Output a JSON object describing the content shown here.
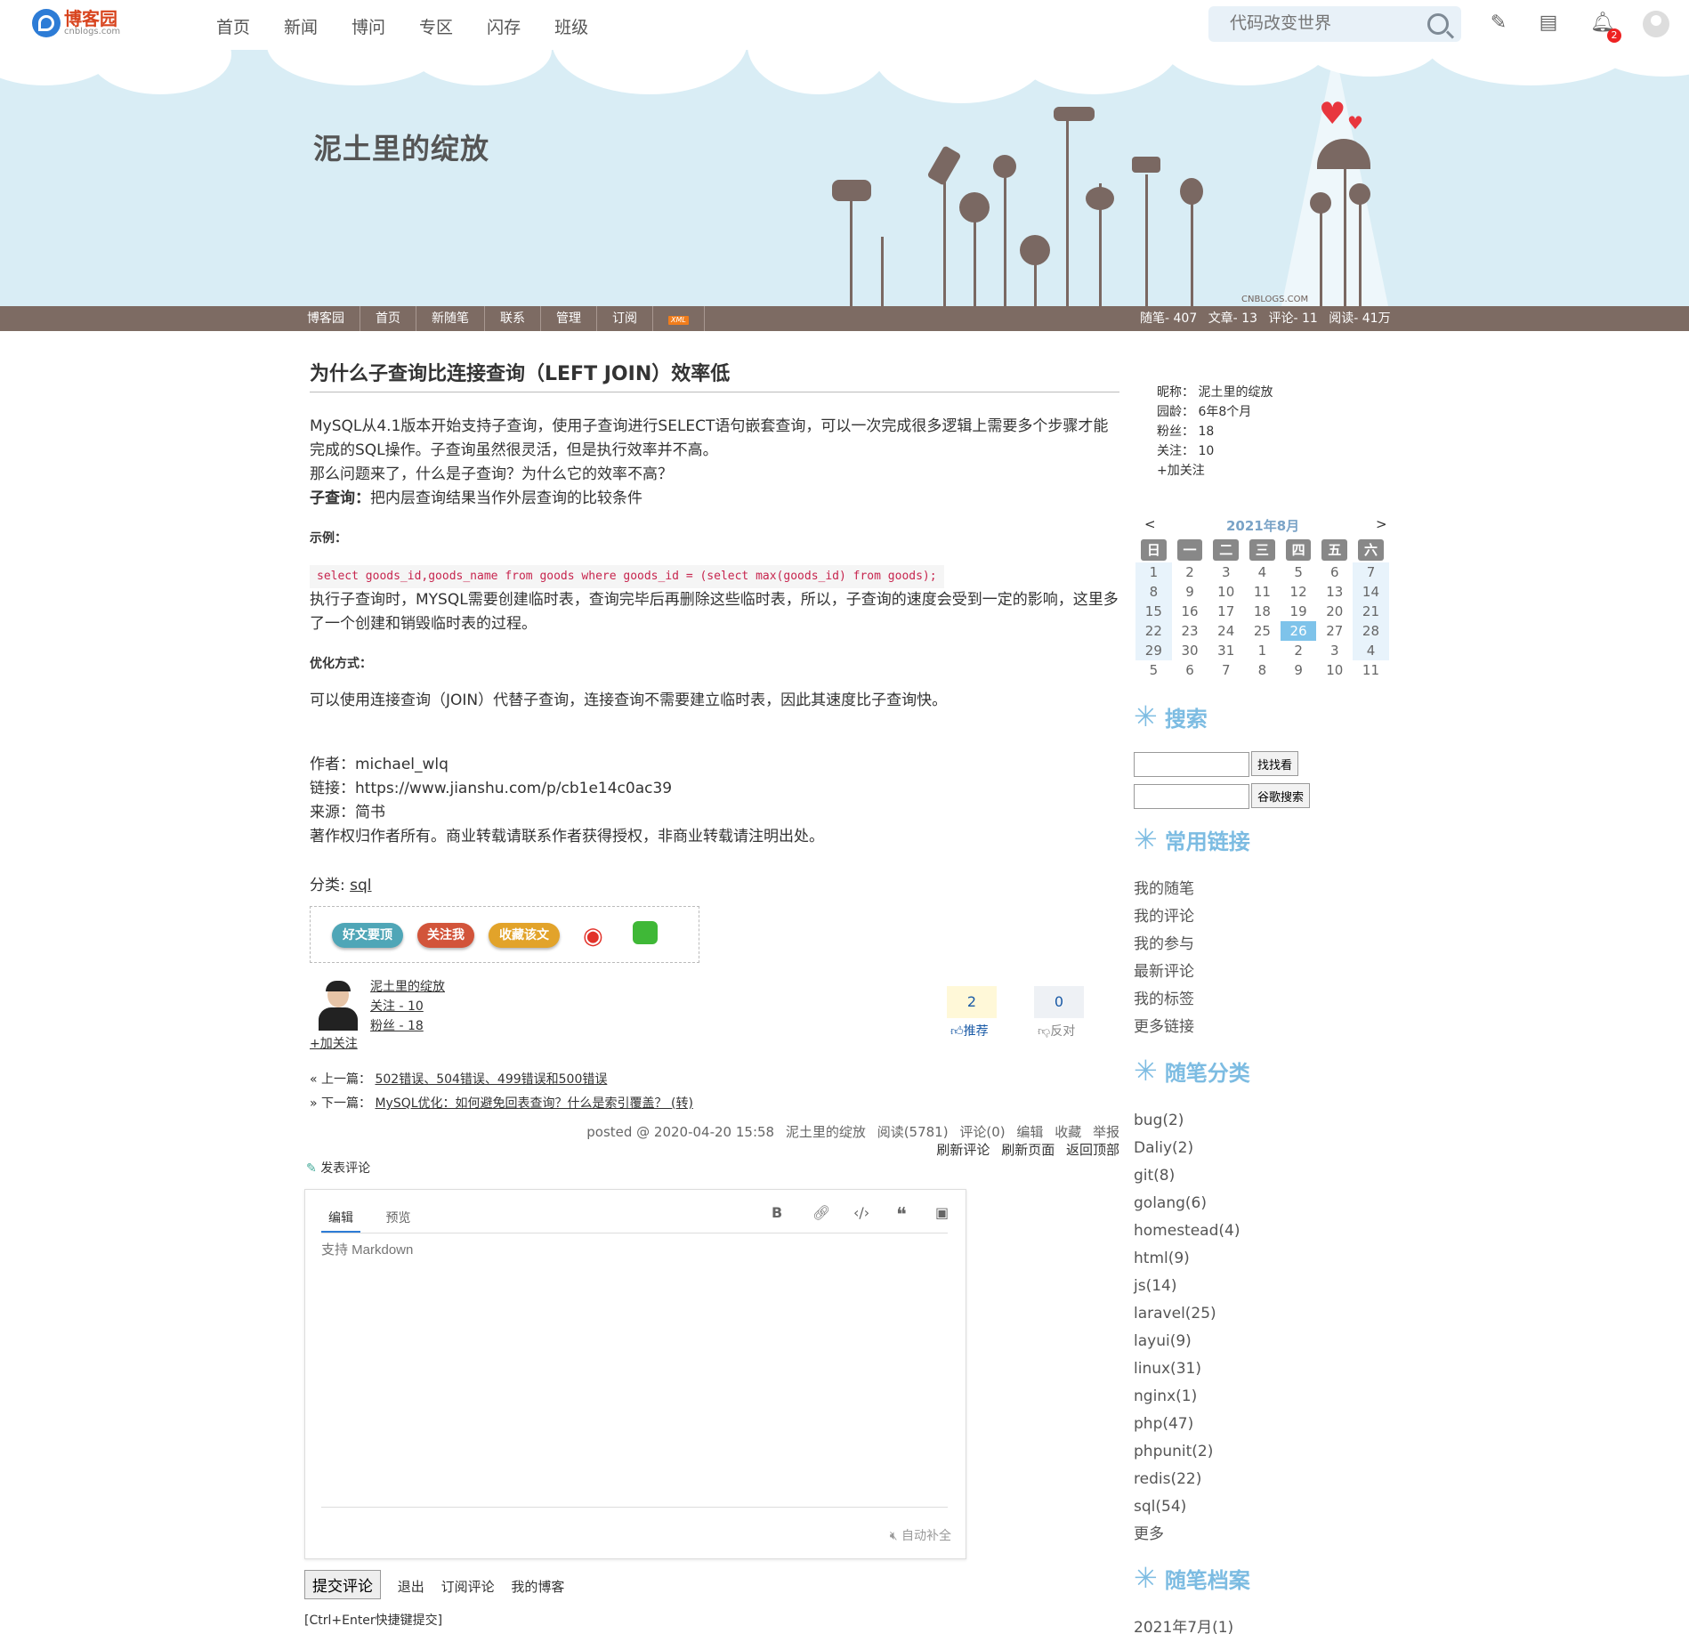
{
  "topnav": {
    "logo_main": "博客园",
    "logo_sub": "cnblogs.com",
    "items": [
      "首页",
      "新闻",
      "博问",
      "专区",
      "闪存",
      "班级"
    ],
    "search_placeholder": "代码改变世界",
    "notification_count": "2"
  },
  "banner": {
    "title": "泥土里的绽放",
    "watermark": "CNBLOGS.COM"
  },
  "subnav": {
    "items": [
      "博客园",
      "首页",
      "新随笔",
      "联系",
      "管理",
      "订阅"
    ],
    "rss": "XML",
    "stats": [
      "随笔- 407",
      "文章- 13",
      "评论- 11",
      "阅读- 41万"
    ]
  },
  "post": {
    "title": "为什么子查询比连接查询（LEFT JOIN）效率低",
    "p1": "MySQL从4.1版本开始支持子查询，使用子查询进行SELECT语句嵌套查询，可以一次完成很多逻辑上需要多个步骤才能完成的SQL操作。子查询虽然很灵活，但是执行效率并不高。",
    "p2": "那么问题来了，什么是子查询？为什么它的效率不高？",
    "p3_bold": "子查询：",
    "p3": "把内层查询结果当作外层查询的比较条件",
    "example_head": "示例：",
    "code": "select goods_id,goods_name from goods where goods_id = (select max(goods_id) from goods);",
    "p4": "执行子查询时，MYSQL需要创建临时表，查询完毕后再删除这些临时表，所以，子查询的速度会受到一定的影响，这里多了一个创建和销毁临时表的过程。",
    "opt_head": "优化方式：",
    "p5": "可以使用连接查询（JOIN）代替子查询，连接查询不需要建立临时表，因此其速度比子查询快。",
    "meta": [
      "作者：michael_wlq",
      "链接：https://www.jianshu.com/p/cb1e14c0ac39",
      "来源：简书",
      "著作权归作者所有。商业转载请联系作者获得授权，非商业转载请注明出处。"
    ],
    "category_label": "分类: ",
    "category": "sql"
  },
  "share": {
    "btn1": "好文要顶",
    "btn2": "关注我",
    "btn3": "收藏该文"
  },
  "author": {
    "name": "泥土里的绽放",
    "follow": "关注 - 10",
    "fans": "粉丝 - 18",
    "add_follow": "+加关注"
  },
  "votes": {
    "up_count": "2",
    "up_label": "推荐",
    "down_count": "0",
    "down_label": "反对"
  },
  "prevnext": {
    "prev_label": "« 上一篇：",
    "prev": "502错误、504错误、499错误和500错误",
    "next_label": "» 下一篇：",
    "next": "MySQL优化：如何避免回表查询？什么是索引覆盖？ (转)"
  },
  "postinfo": {
    "line1": [
      "posted @ 2020-04-20 15:58",
      "泥土里的绽放",
      "阅读(5781)",
      "评论(0)",
      "编辑",
      "收藏",
      "举报"
    ],
    "line2": [
      "刷新评论",
      "刷新页面",
      "返回顶部"
    ]
  },
  "comment": {
    "head": "发表评论",
    "tab_edit": "编辑",
    "tab_preview": "预览",
    "placeholder": "支持 Markdown",
    "autocomplete": "自动补全",
    "submit": "提交评论",
    "links": [
      "退出",
      "订阅评论",
      "我的博客"
    ],
    "hint": "[Ctrl+Enter快捷键提交]"
  },
  "profile": {
    "lines": [
      "昵称：  泥土里的绽放",
      "园龄：  6年8个月",
      "粉丝：  18",
      "关注：  10",
      "+加关注"
    ]
  },
  "calendar": {
    "prev": "<",
    "next": ">",
    "title": "2021年8月",
    "heads": [
      "日",
      "一",
      "二",
      "三",
      "四",
      "五",
      "六"
    ],
    "days": [
      "1",
      "2",
      "3",
      "4",
      "5",
      "6",
      "7",
      "8",
      "9",
      "10",
      "11",
      "12",
      "13",
      "14",
      "15",
      "16",
      "17",
      "18",
      "19",
      "20",
      "21",
      "22",
      "23",
      "24",
      "25",
      "26",
      "27",
      "28",
      "29",
      "30",
      "31",
      "1",
      "2",
      "3",
      "4",
      "5",
      "6",
      "7",
      "8",
      "9",
      "10",
      "11"
    ],
    "today": "26"
  },
  "sidebar": {
    "search_title": "搜索",
    "search_btn1": "找找看",
    "search_btn2": "谷歌搜索",
    "links_title": "常用链接",
    "links": [
      "我的随笔",
      "我的评论",
      "我的参与",
      "最新评论",
      "我的标签",
      "更多链接"
    ],
    "cat_title": "随笔分类",
    "cats": [
      "bug(2)",
      "Daliy(2)",
      "git(8)",
      "golang(6)",
      "homestead(4)",
      "html(9)",
      "js(14)",
      "laravel(25)",
      "layui(9)",
      "linux(31)",
      "nginx(1)",
      "php(47)",
      "phpunit(2)",
      "redis(22)",
      "sql(54)",
      "更多"
    ],
    "archive_title": "随笔档案",
    "archive": [
      "2021年7月(1)"
    ]
  }
}
